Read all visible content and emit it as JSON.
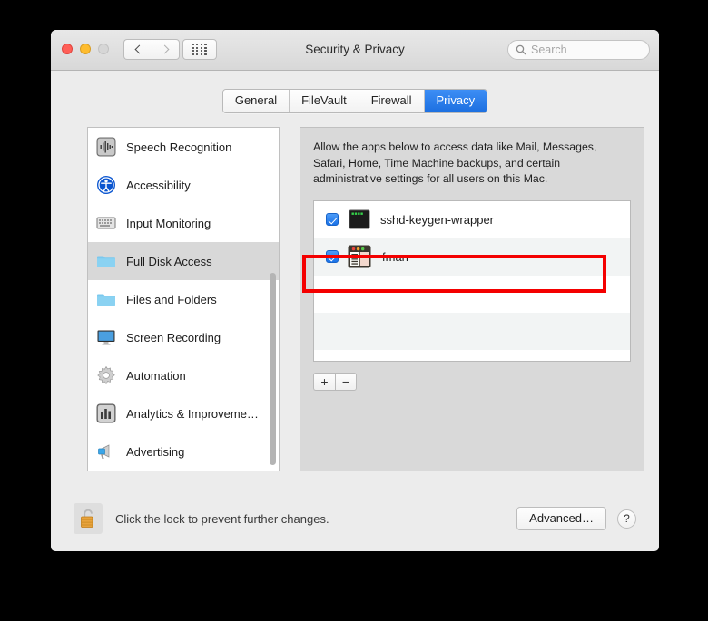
{
  "window": {
    "title": "Security & Privacy",
    "traffic_lights": [
      "close",
      "minimize",
      "zoom"
    ],
    "back_label": "Back",
    "forward_label": "Forward",
    "grid_label": "Show All"
  },
  "search": {
    "placeholder": "Search",
    "value": "",
    "icon": "search-icon"
  },
  "tabs": [
    {
      "label": "General",
      "active": false
    },
    {
      "label": "FileVault",
      "active": false
    },
    {
      "label": "Firewall",
      "active": false
    },
    {
      "label": "Privacy",
      "active": true
    }
  ],
  "sidebar": {
    "items": [
      {
        "label": "Speech Recognition",
        "icon": "waveform-icon",
        "selected": false
      },
      {
        "label": "Accessibility",
        "icon": "accessibility-icon",
        "selected": false
      },
      {
        "label": "Input Monitoring",
        "icon": "keyboard-icon",
        "selected": false
      },
      {
        "label": "Full Disk Access",
        "icon": "folder-icon",
        "selected": true
      },
      {
        "label": "Files and Folders",
        "icon": "folder-icon",
        "selected": false
      },
      {
        "label": "Screen Recording",
        "icon": "display-icon",
        "selected": false
      },
      {
        "label": "Automation",
        "icon": "gear-icon",
        "selected": false
      },
      {
        "label": "Analytics & Improveme…",
        "icon": "bar-chart-icon",
        "selected": false
      },
      {
        "label": "Advertising",
        "icon": "megaphone-icon",
        "selected": false
      }
    ]
  },
  "panel": {
    "description": "Allow the apps below to access data like Mail, Messages, Safari, Home, Time Machine backups, and certain administrative settings for all users on this Mac.",
    "apps": [
      {
        "name": "sshd-keygen-wrapper",
        "checked": true,
        "icon": "terminal-icon",
        "highlighted": false
      },
      {
        "name": "fman",
        "checked": true,
        "icon": "fman-icon",
        "highlighted": true
      }
    ],
    "add_label": "+",
    "remove_label": "−"
  },
  "footer": {
    "lock_icon": "unlocked-padlock-icon",
    "lock_text": "Click the lock to prevent further changes.",
    "advanced_label": "Advanced…",
    "help_label": "?"
  },
  "colors": {
    "accent": "#1c6fe0",
    "highlight_red": "#f40000",
    "selected_row": "#d8d8d8"
  }
}
